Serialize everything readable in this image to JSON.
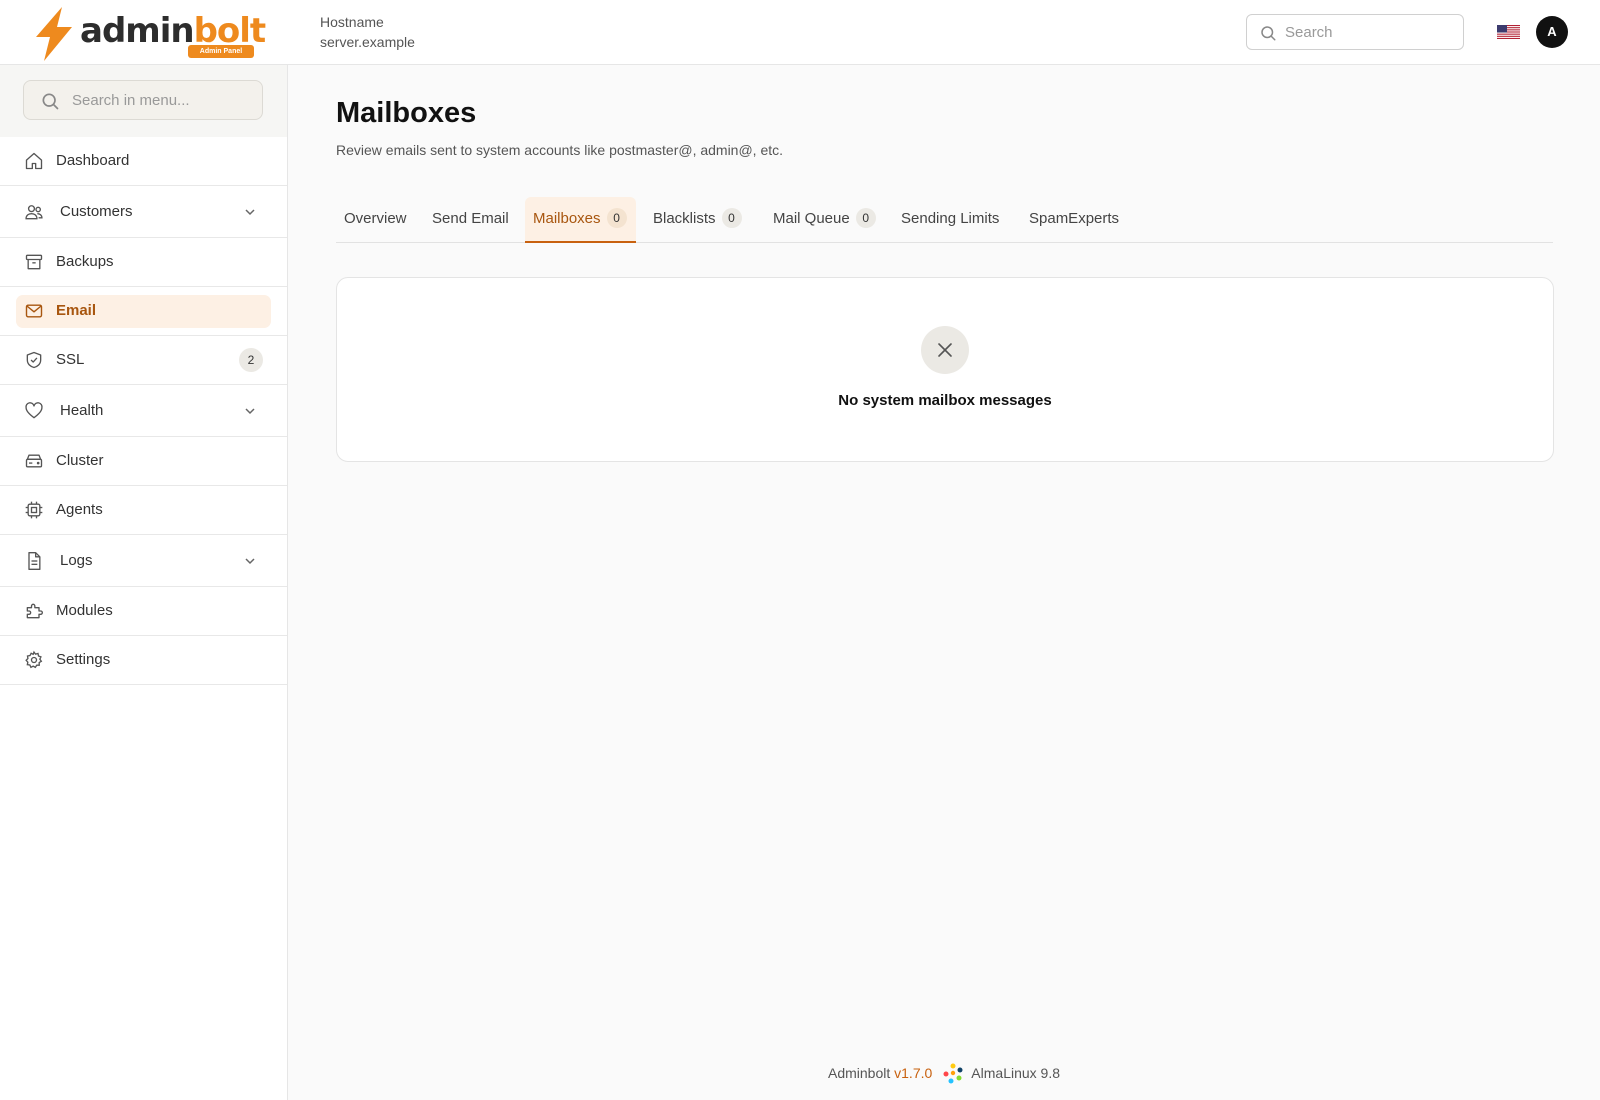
{
  "header": {
    "logo_word_1": "admin",
    "logo_word_2": "bolt",
    "logo_badge": "Admin Panel",
    "hostname_label": "Hostname",
    "hostname_value": "server.example",
    "search_placeholder": "Search",
    "avatar_initial": "A",
    "flag": "us-flag-icon"
  },
  "sidebar": {
    "search_placeholder": "Search in menu...",
    "items": [
      {
        "label": "Dashboard",
        "icon": "home-icon"
      },
      {
        "label": "Customers",
        "icon": "users-icon",
        "expandable": true
      },
      {
        "label": "Backups",
        "icon": "archive-icon"
      },
      {
        "label": "Email",
        "icon": "mail-icon",
        "active": true
      },
      {
        "label": "SSL",
        "icon": "shield-check-icon",
        "count": "2"
      },
      {
        "label": "Health",
        "icon": "heart-icon",
        "expandable": true
      },
      {
        "label": "Cluster",
        "icon": "server-icon"
      },
      {
        "label": "Agents",
        "icon": "cpu-icon"
      },
      {
        "label": "Logs",
        "icon": "file-text-icon",
        "expandable": true
      },
      {
        "label": "Modules",
        "icon": "puzzle-icon"
      },
      {
        "label": "Settings",
        "icon": "gear-icon"
      }
    ]
  },
  "main": {
    "title": "Mailboxes",
    "subtitle": "Review emails sent to system accounts like postmaster@, admin@, etc.",
    "tabs": [
      {
        "label": "Overview"
      },
      {
        "label": "Send Email"
      },
      {
        "label": "Mailboxes",
        "badge": "0",
        "active": true
      },
      {
        "label": "Blacklists",
        "badge": "0"
      },
      {
        "label": "Mail Queue",
        "badge": "0"
      },
      {
        "label": "Sending Limits"
      },
      {
        "label": "SpamExperts"
      }
    ],
    "empty_state": {
      "icon": "x-icon",
      "text": "No system mailbox messages"
    }
  },
  "footer": {
    "product": "Adminbolt",
    "version": "v1.7.0",
    "os": "AlmaLinux 9.8"
  },
  "colors": {
    "accent": "#ee8a1e",
    "active_text": "#a8560f",
    "active_bg": "#fdf0e4"
  }
}
